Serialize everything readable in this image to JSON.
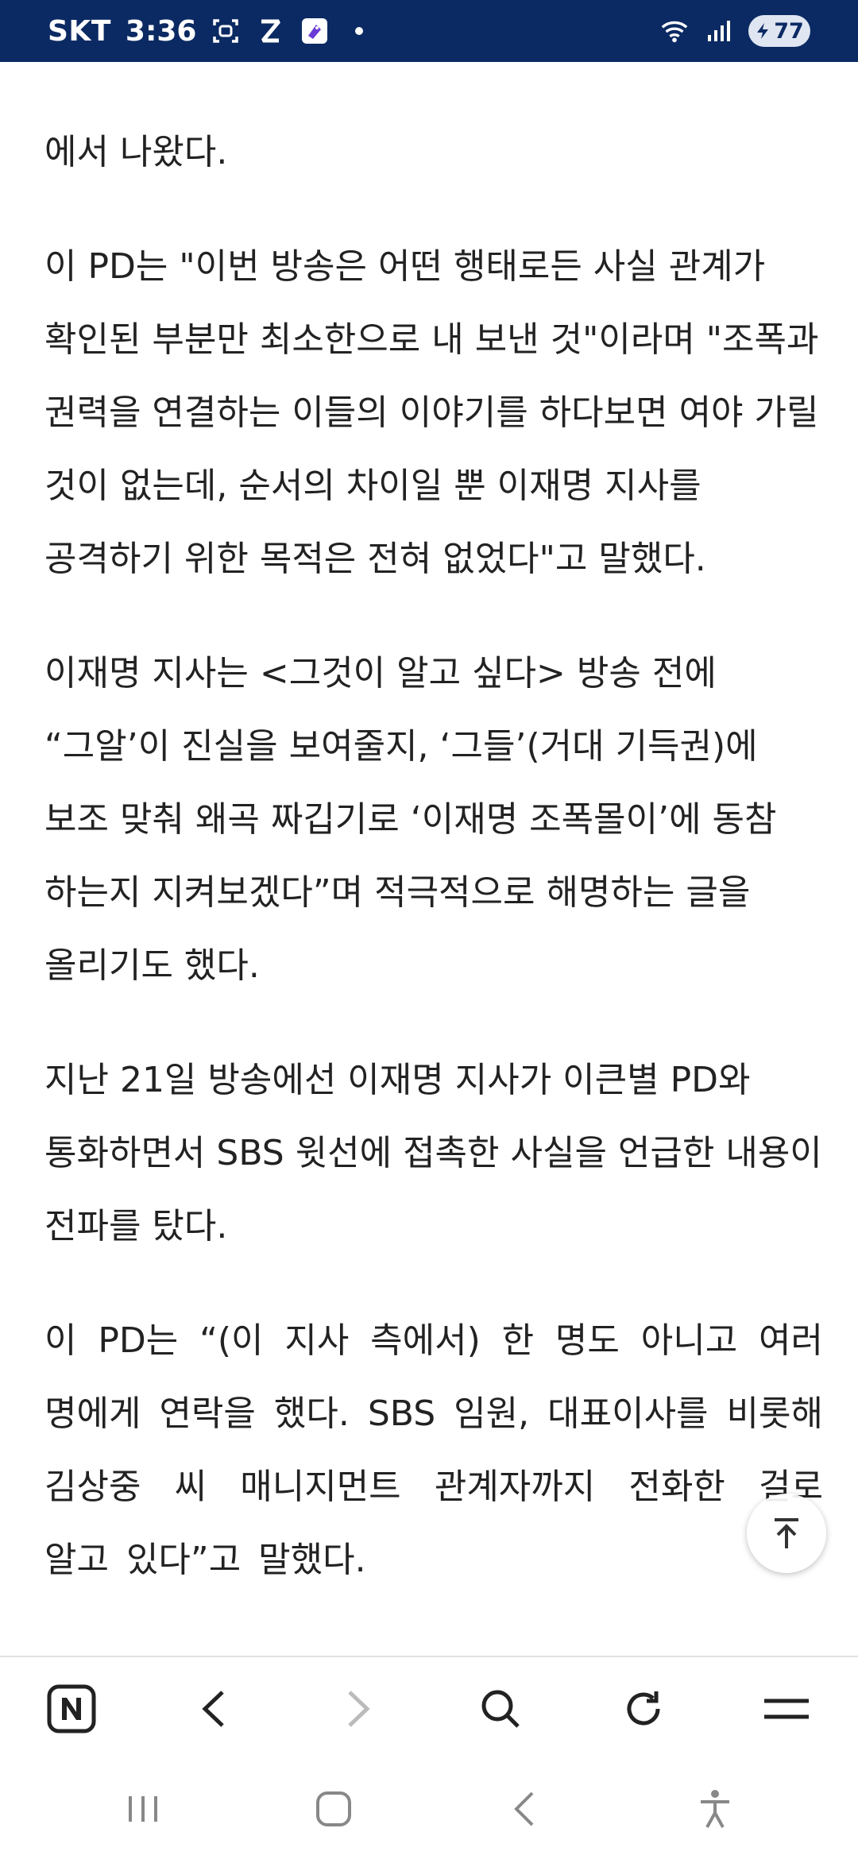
{
  "status_bar": {
    "carrier": "SKT",
    "time": "3:36",
    "battery": "77",
    "icons": [
      "face-scan-icon",
      "z-app-icon",
      "tag-app-icon",
      "notification-dot-icon",
      "wifi-icon",
      "signal-icon",
      "battery-icon"
    ]
  },
  "article": {
    "paragraphs": [
      "에서 나왔다.",
      "이 PD는 \"이번 방송은 어떤 행태로든 사실 관계가 확인된 부분만 최소한으로 내 보낸 것\"이라며 \"조폭과 권력을 연결하는 이들의 이야기를 하다보면 여야 가릴 것이 없는데, 순서의 차이일 뿐 이재명 지사를 공격하기 위한 목적은 전혀 없었다\"고 말했다.",
      "이재명 지사는 <그것이 알고 싶다> 방송 전에 “그알’이 진실을 보여줄지, ‘그들’(거대 기득권)에 보조 맞춰 왜곡 짜깁기로 ‘이재명 조폭몰이’에 동참 하는지 지켜보겠다”며 적극적으로 해명하는 글을 올리기도 했다.",
      "지난 21일 방송에선 이재명 지사가 이큰별 PD와 통화하면서 SBS 윗선에 접촉한 사실을 언급한 내용이 전파를 탔다.",
      "이 PD는 “(이 지사 측에서) 한 명도 아니고 여러 명에게 연락을 했다. SBS 임원, 대표이사를 비롯해 김상중 씨 매니지먼트 관계자까지 전화한 걸로 알고 있다”고 말했다."
    ]
  },
  "scroll_top": {
    "icon": "arrow-up-icon"
  },
  "toolbar": {
    "items": [
      "naver-home-icon",
      "back-icon",
      "forward-icon",
      "search-icon",
      "refresh-icon",
      "menu-icon"
    ]
  },
  "system_nav": {
    "items": [
      "recent-apps-icon",
      "home-icon",
      "system-back-icon",
      "accessibility-icon"
    ]
  }
}
